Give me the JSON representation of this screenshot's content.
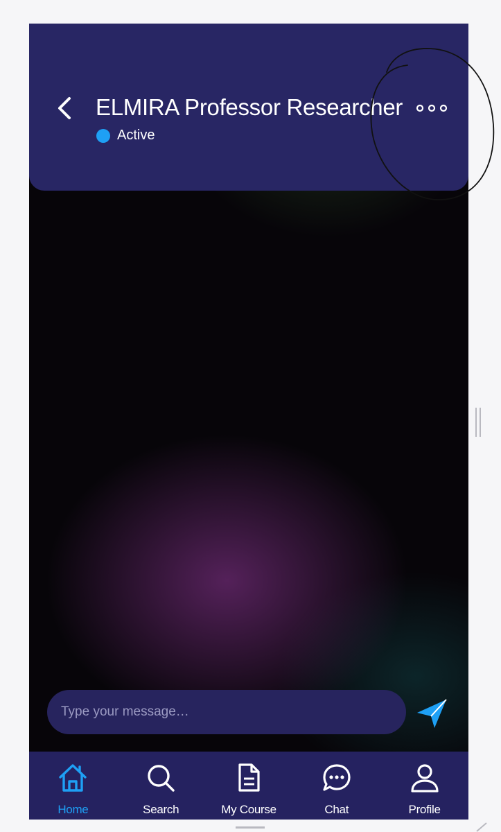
{
  "header": {
    "title": "ELMIRA Professor Researcher",
    "status": "Active",
    "status_color": "#1ea0f5",
    "back_icon": "chevron-left-icon",
    "more_icon": "more-horizontal-icon",
    "background": "#282664"
  },
  "composer": {
    "placeholder": "Type your message…",
    "value": "",
    "send_icon": "send-icon",
    "send_color": "#1ea0f5"
  },
  "nav": {
    "active": "home",
    "active_color": "#1ea0f5",
    "items": [
      {
        "id": "home",
        "label": "Home",
        "icon": "home-icon"
      },
      {
        "id": "search",
        "label": "Search",
        "icon": "search-icon"
      },
      {
        "id": "my-course",
        "label": "My Course",
        "icon": "document-icon"
      },
      {
        "id": "chat",
        "label": "Chat",
        "icon": "chat-bubble-icon"
      },
      {
        "id": "profile",
        "label": "Profile",
        "icon": "user-icon"
      }
    ]
  }
}
